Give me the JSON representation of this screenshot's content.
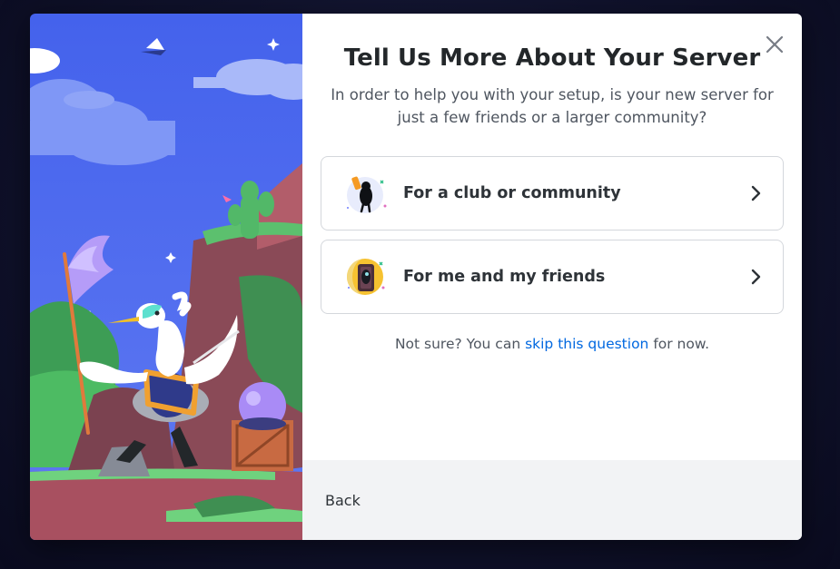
{
  "modal": {
    "title": "Tell Us More About Your Server",
    "subtitle": "In order to help you with your setup, is your new server for just a few friends or a larger community?",
    "options": [
      {
        "label": "For a club or community",
        "icon": "club-community-icon"
      },
      {
        "label": "For me and my friends",
        "icon": "friends-icon"
      }
    ],
    "helper": {
      "prefix": "Not sure? You can ",
      "link": "skip this question",
      "suffix": " for now."
    },
    "back_label": "Back",
    "close_icon": "close-icon"
  },
  "colors": {
    "link": "#0068e0",
    "title": "#23272a",
    "body_text": "#4f5660",
    "footer_bg": "#f2f3f5",
    "sky": "#4f6ef0"
  }
}
